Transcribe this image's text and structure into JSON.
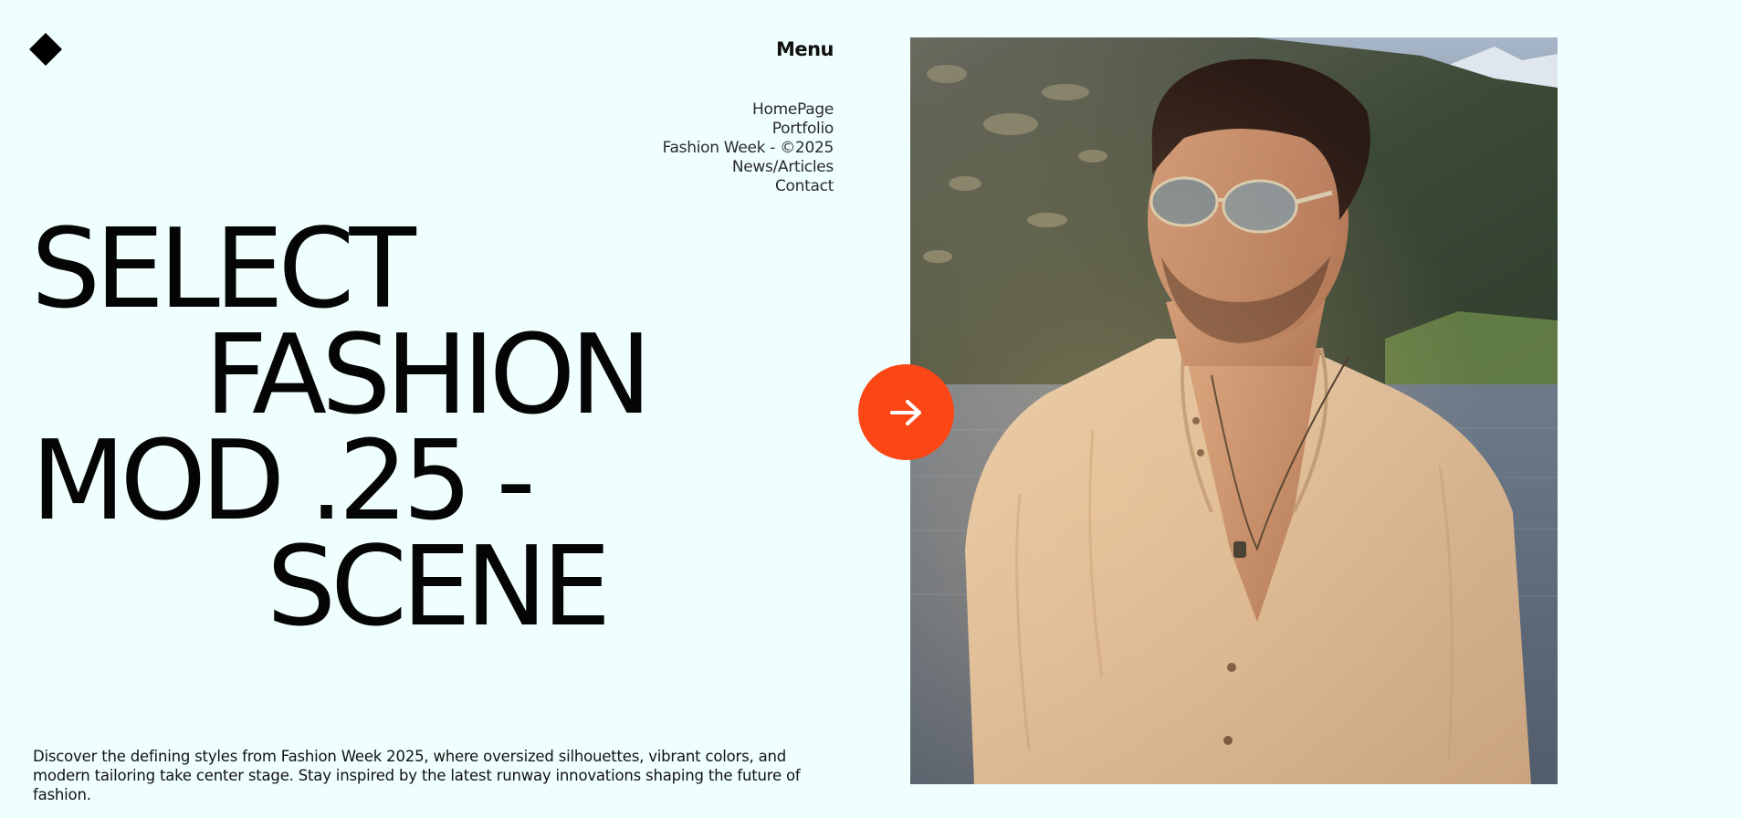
{
  "brand": {
    "logo_icon": "diamond-icon",
    "color": "#000000"
  },
  "menu": {
    "title": "Menu",
    "items": [
      {
        "label": "HomePage"
      },
      {
        "label": "Portfolio"
      },
      {
        "label": "Fashion Week - ©2025"
      },
      {
        "label": "News/Articles"
      },
      {
        "label": "Contact"
      }
    ]
  },
  "hero": {
    "headline_lines": [
      "SELECT",
      "FASHION",
      "MOD .25 -",
      "SCENE"
    ],
    "description": "Discover the defining styles from Fashion Week 2025, where oversized silhouettes, vibrant colors, and modern tailoring take center stage. Stay inspired by the latest runway innovations shaping the future of fashion."
  },
  "cta": {
    "icon": "arrow-right-icon",
    "color": "#fb4616"
  },
  "photo": {
    "subject": "man-in-linen-shirt-photo"
  },
  "colors": {
    "background": "#effffe",
    "accent": "#fb4616",
    "text": "#0d0d0d"
  }
}
